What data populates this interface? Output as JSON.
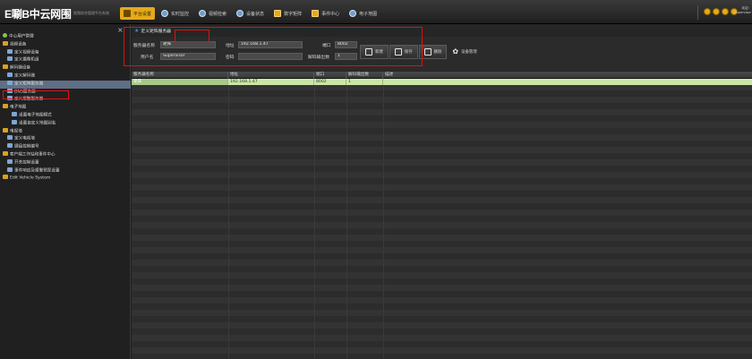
{
  "app": {
    "logo": "E唰B中云网围",
    "logo_sub": "视频综合管理平台系统"
  },
  "nav_tabs": [
    {
      "label": "平台设置",
      "active": true
    },
    {
      "label": "实时监控",
      "active": false
    },
    {
      "label": "视频检索",
      "active": false
    },
    {
      "label": "设备状态",
      "active": false
    },
    {
      "label": "数字矩阵",
      "active": false
    },
    {
      "label": "事件中心",
      "active": false
    },
    {
      "label": "电子地图",
      "active": false
    }
  ],
  "user": {
    "greeting": "欢迎：",
    "name": "Supervisor"
  },
  "sidebar": {
    "close_label": "×",
    "items": [
      {
        "label": "中心用户管理",
        "depth": 0,
        "icon": "user-icon"
      },
      {
        "label": "视频设备",
        "depth": 0,
        "icon": "folder-icon"
      },
      {
        "label": "定义视频设备",
        "depth": 1,
        "icon": "device-icon"
      },
      {
        "label": "定义摄像机组",
        "depth": 1,
        "icon": "device-icon"
      },
      {
        "label": "解码器设备",
        "depth": 0,
        "icon": "folder-icon"
      },
      {
        "label": "定义解码器",
        "depth": 1,
        "icon": "device-icon"
      },
      {
        "label": "定义矩阵服务器",
        "depth": 1,
        "icon": "device-icon",
        "selected": true
      },
      {
        "label": "DNS服务器",
        "depth": 1,
        "icon": "device-icon"
      },
      {
        "label": "定义报警服务器",
        "depth": 1,
        "icon": "device-icon"
      },
      {
        "label": "电子地图",
        "depth": 0,
        "icon": "folder-icon"
      },
      {
        "label": "设置电子地图模式",
        "depth": 2,
        "icon": "map-icon"
      },
      {
        "label": "设置自定义地图别名",
        "depth": 2,
        "icon": "map-icon"
      },
      {
        "label": "电视墙",
        "depth": 0,
        "icon": "folder-icon"
      },
      {
        "label": "定义电视墙",
        "depth": 1,
        "icon": "device-icon"
      },
      {
        "label": "键盘控制编号",
        "depth": 1,
        "icon": "keyboard-icon"
      },
      {
        "label": "客户端工作站和事件中心",
        "depth": 0,
        "icon": "folder-icon"
      },
      {
        "label": "开关控制设置",
        "depth": 1,
        "icon": "switch-icon"
      },
      {
        "label": "事件响应及报警预案设置",
        "depth": 1,
        "icon": "switch-icon"
      },
      {
        "label": "Edit Vehicle System",
        "depth": 0,
        "icon": "folder-icon"
      }
    ]
  },
  "panel": {
    "title": "定义矩阵服务器"
  },
  "form": {
    "server_name_label": "服务器名称",
    "server_name_value": "矩阵",
    "address_label": "地址",
    "address_value": "192.168.1.47",
    "port_label": "端口",
    "port_value": "8002",
    "username_label": "用户名",
    "username_value": "Supervisor",
    "password_label": "密码",
    "password_value": "",
    "decoder_outputs_label": "解码输出数",
    "decoder_outputs_value": "1"
  },
  "toolbar": {
    "new_label": "新建",
    "save_label": "保存",
    "delete_label": "删除",
    "settings_label": "设备管理"
  },
  "grid": {
    "columns": [
      "服务器名称",
      "地址",
      "端口",
      "解码输出数",
      "描述"
    ],
    "rows": [
      {
        "cells": [
          "矩阵",
          "192.168.1.47",
          "8002",
          "1",
          ""
        ],
        "selected": true
      }
    ]
  }
}
